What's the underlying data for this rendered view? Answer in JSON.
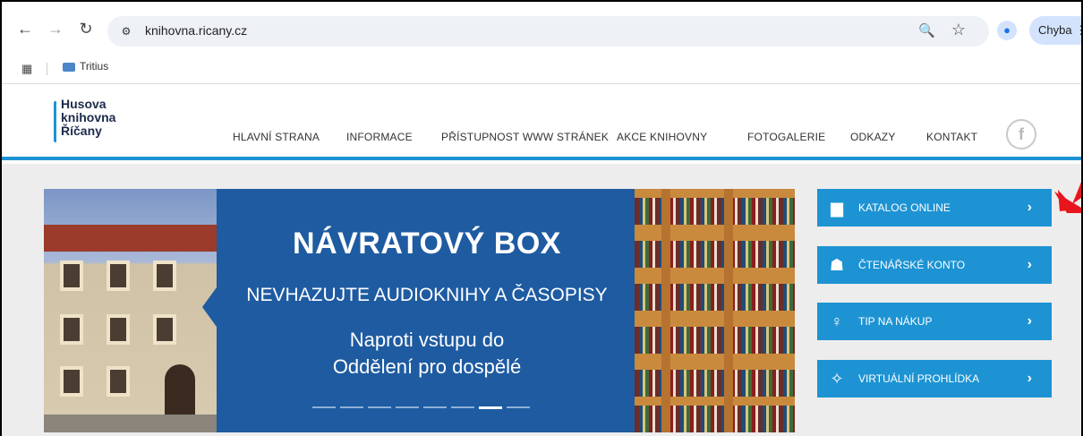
{
  "browser": {
    "url": "knihovna.ricany.cz",
    "profile_status": "Chyba",
    "bookmarks": [
      {
        "label": "Tritius"
      }
    ]
  },
  "site": {
    "logo": {
      "line1": "Husova",
      "line2": "knihovna",
      "line3": "Říčany"
    },
    "menu": [
      {
        "label": "HLAVNÍ STRANA"
      },
      {
        "label": "INFORMACE"
      },
      {
        "label": "PŘÍSTUPNOST WWW STRÁNEK"
      },
      {
        "label": "AKCE KNIHOVNY"
      },
      {
        "label": "FOTOGALERIE"
      },
      {
        "label": "ODKAZY"
      },
      {
        "label": "KONTAKT"
      }
    ]
  },
  "banner": {
    "title": "NÁVRATOVÝ BOX",
    "subtitle": "NEVHAZUJTE AUDIOKNIHY A ČASOPISY",
    "note_line1": "Naproti vstupu do",
    "note_line2": "Oddělení pro dospělé",
    "slide_count": 8,
    "active_slide": 7
  },
  "side_links": [
    {
      "label": "KATALOG ONLINE",
      "icon": "book-icon"
    },
    {
      "label": "ČTENÁŘSKÉ KONTO",
      "icon": "reader-icon"
    },
    {
      "label": "TIP NA NÁKUP",
      "icon": "lightbulb-icon"
    },
    {
      "label": "VIRTUÁLNÍ PROHLÍDKA",
      "icon": "compass-icon"
    }
  ],
  "colors": {
    "accent": "#1d93d3",
    "banner_blue": "#1e5ba1",
    "annotation_arrow": "#e8161c"
  }
}
